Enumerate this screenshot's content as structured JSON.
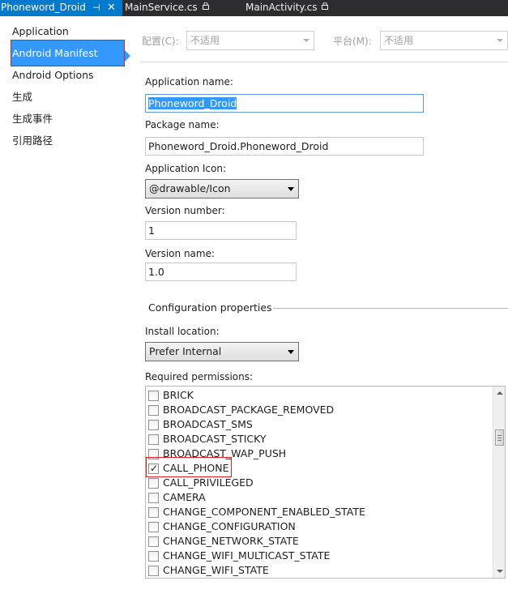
{
  "tabs": [
    {
      "label": "Phoneword_Droid",
      "pin": "⊣",
      "close": "✕",
      "active": true
    },
    {
      "label": "MainService.cs",
      "lock": "🔒",
      "active": false
    },
    {
      "label": "MainActivity.cs",
      "lock": "🔒",
      "active": false
    }
  ],
  "nav": {
    "items": [
      {
        "label": "Application"
      },
      {
        "label": "Android Manifest",
        "selected": true
      },
      {
        "label": "Android Options"
      },
      {
        "label": "生成"
      },
      {
        "label": "生成事件"
      },
      {
        "label": "引用路径"
      }
    ]
  },
  "config": {
    "configuration_label": "配置(C):",
    "configuration_value": "不适用",
    "platform_label": "平台(M):",
    "platform_value": "不适用"
  },
  "form": {
    "app_name_label": "Application name:",
    "app_name_value": "Phoneword_Droid",
    "package_name_label": "Package name:",
    "package_name_value": "Phoneword_Droid.Phoneword_Droid",
    "app_icon_label": "Application Icon:",
    "app_icon_value": "@drawable/Icon",
    "version_number_label": "Version number:",
    "version_number_value": "1",
    "version_name_label": "Version name:",
    "version_name_value": "1.0",
    "config_section_title": "Configuration properties",
    "install_location_label": "Install location:",
    "install_location_value": "Prefer Internal",
    "permissions_label": "Required permissions:"
  },
  "permissions": [
    {
      "name": "BRICK",
      "checked": false
    },
    {
      "name": "BROADCAST_PACKAGE_REMOVED",
      "checked": false
    },
    {
      "name": "BROADCAST_SMS",
      "checked": false
    },
    {
      "name": "BROADCAST_STICKY",
      "checked": false
    },
    {
      "name": "BROADCAST_WAP_PUSH",
      "checked": false
    },
    {
      "name": "CALL_PHONE",
      "checked": true
    },
    {
      "name": "CALL_PRIVILEGED",
      "checked": false
    },
    {
      "name": "CAMERA",
      "checked": false
    },
    {
      "name": "CHANGE_COMPONENT_ENABLED_STATE",
      "checked": false
    },
    {
      "name": "CHANGE_CONFIGURATION",
      "checked": false
    },
    {
      "name": "CHANGE_NETWORK_STATE",
      "checked": false
    },
    {
      "name": "CHANGE_WIFI_MULTICAST_STATE",
      "checked": false
    },
    {
      "name": "CHANGE_WIFI_STATE",
      "checked": false
    }
  ],
  "colors": {
    "accent": "#007acc",
    "selection": "#3399ff",
    "annotation": "#e02020"
  }
}
